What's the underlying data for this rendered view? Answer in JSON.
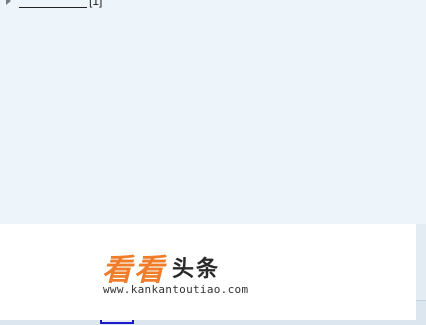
{
  "tree": {
    "footnote": "[1]"
  },
  "watermark": {
    "brand_orange": "看看",
    "brand_dark": "头条",
    "url": "www.kankantoutiao.com",
    "accent_color": "#ef7d2a"
  },
  "status_bar": {
    "icons": [
      "layout-icon",
      "view-icon",
      "view-icon",
      "focus-icon",
      "zoom-icon"
    ]
  }
}
